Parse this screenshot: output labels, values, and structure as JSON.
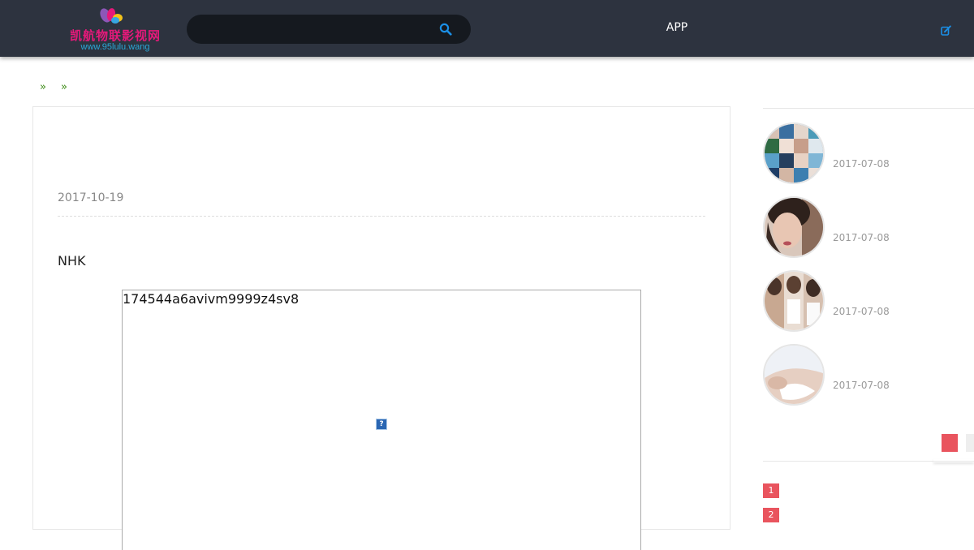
{
  "header": {
    "logo": {
      "site_name": "凯航物联影视网",
      "site_url": "www.95lulu.wang"
    },
    "search": {
      "placeholder": "",
      "value": ""
    },
    "nav": {
      "app_label": "APP"
    },
    "icons": {
      "search": "search-icon",
      "edit": "edit-icon"
    }
  },
  "breadcrumb": {
    "separators": [
      "»",
      "»"
    ]
  },
  "article": {
    "date": "2017-10-19",
    "text": "NHK",
    "embed": {
      "text": "174544a6avivm9999z4sv8",
      "broken_image_glyph": "?"
    }
  },
  "sidebar": {
    "items": [
      {
        "date": "2017-07-08"
      },
      {
        "date": "2017-07-08"
      },
      {
        "date": "2017-07-08"
      },
      {
        "date": "2017-07-08"
      }
    ],
    "ranks": [
      "1",
      "2"
    ]
  },
  "colors": {
    "header_bg": "#2d333f",
    "search_bg": "#15191f",
    "accent_blue": "#1b8fe6",
    "accent_red": "#e9545e",
    "breadcrumb_green": "#3d8b16"
  }
}
